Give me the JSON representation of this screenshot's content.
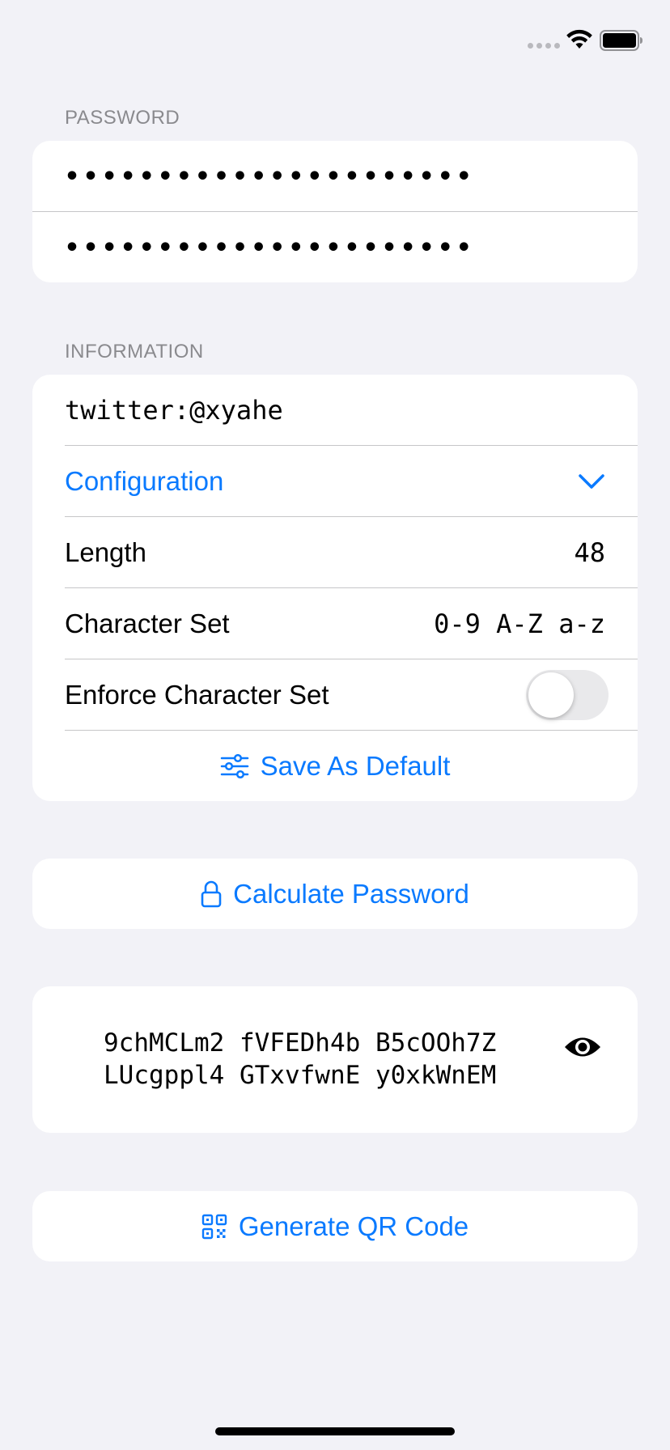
{
  "sections": {
    "password_header": "PASSWORD",
    "information_header": "INFORMATION"
  },
  "password": {
    "field1_value": "••••••••••••••••••••••",
    "field2_value": "••••••••••••••••••••••"
  },
  "information": {
    "site_value": "twitter:@xyahe",
    "configuration_label": "Configuration",
    "length_label": "Length",
    "length_value": "48",
    "charset_label": "Character Set",
    "charset_value": "0-9 A-Z a-z",
    "enforce_label": "Enforce Character Set",
    "enforce_enabled": false,
    "save_default_label": "Save As Default"
  },
  "actions": {
    "calculate_label": "Calculate Password",
    "qr_label": "Generate QR Code"
  },
  "result": {
    "password_text": "9chMCLm2 fVFEDh4b B5cOOh7Z\nLUcgppl4 GTxvfwnE y0xkWnEM"
  },
  "icons": {
    "wifi": "wifi-icon",
    "battery": "battery-icon",
    "chevron": "chevron-down-icon",
    "sliders": "sliders-icon",
    "lock": "lock-icon",
    "eye": "eye-icon",
    "qr": "qrcode-icon"
  },
  "colors": {
    "accent": "#0a7aff",
    "background": "#f2f2f7",
    "card": "#ffffff",
    "secondary_text": "#8a8a8e"
  }
}
